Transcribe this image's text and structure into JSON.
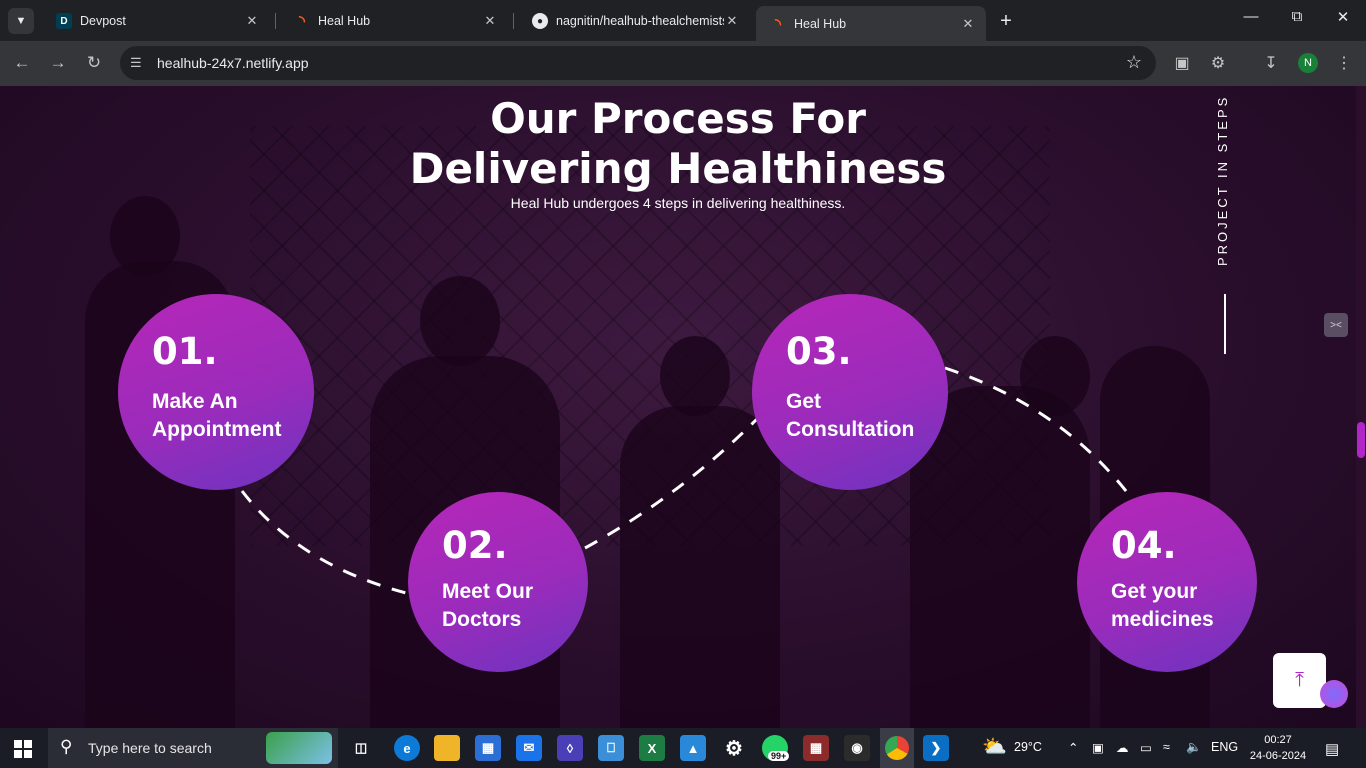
{
  "browser": {
    "tabs": [
      {
        "title": "Devpost",
        "favicon": "D",
        "active": false
      },
      {
        "title": "Heal Hub",
        "favicon": "",
        "active": false
      },
      {
        "title": "nagnitin/healhub-thealchemists",
        "favicon": "",
        "active": false
      },
      {
        "title": "Heal Hub",
        "favicon": "",
        "active": true
      }
    ],
    "url": "healhub-24x7.netlify.app",
    "profile_initial": "N"
  },
  "page": {
    "heading_line1": "Our Process For",
    "heading_line2": "Delivering Healthiness",
    "subtitle": "Heal Hub undergoes 4 steps in delivering healthiness.",
    "side_label": "PROJECT IN STEPS",
    "steps": [
      {
        "number": "01.",
        "label_line1": "Make An",
        "label_line2": "Appointment"
      },
      {
        "number": "02.",
        "label_line1": "Meet Our",
        "label_line2": "Doctors"
      },
      {
        "number": "03.",
        "label_line1": "Get",
        "label_line2": "Consultation"
      },
      {
        "number": "04.",
        "label_line1": "Get your",
        "label_line2": "medicines"
      }
    ],
    "accent_color": "#b026c8",
    "scroll_top_icon": "arrow-up-icon"
  },
  "taskbar": {
    "search_placeholder": "Type here to search",
    "weather_temp": "29°C",
    "language": "ENG",
    "time": "00:27",
    "date": "24-06-2024",
    "whatsapp_badge": "99+"
  }
}
